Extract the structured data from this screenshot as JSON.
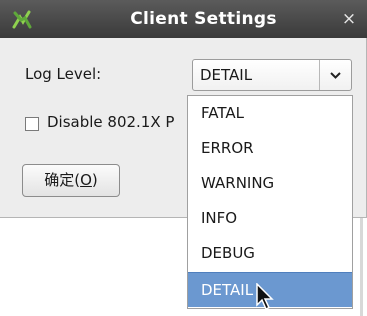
{
  "window": {
    "title": "Client Settings",
    "close_glyph": "×",
    "icon": "app-icon"
  },
  "form": {
    "log_level_label": "Log Level:",
    "log_level_value": "DETAIL",
    "disable_8021x_label": "Disable 802.1X P",
    "disable_8021x_checked": false,
    "ok_button_prefix": "确定(",
    "ok_button_mnemonic": "O",
    "ok_button_suffix": ")"
  },
  "dropdown": {
    "options": [
      "FATAL",
      "ERROR",
      "WARNING",
      "INFO",
      "DEBUG",
      "DETAIL"
    ],
    "selected": "DETAIL"
  },
  "colors": {
    "titlebar": "#444444",
    "selection": "#6b98d0",
    "dialog_bg": "#ededed"
  }
}
